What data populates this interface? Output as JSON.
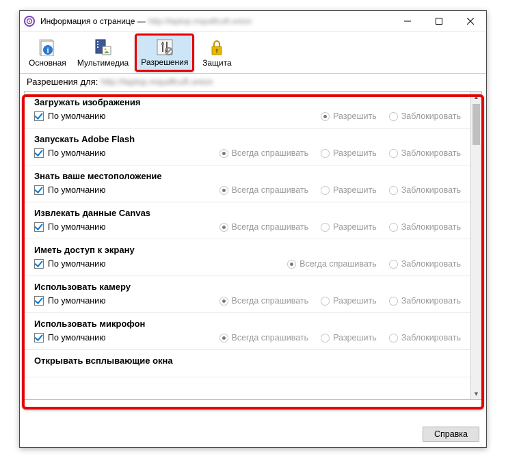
{
  "title_prefix": "Информация о странице —",
  "title_blur": "http://laptop.mqudfcuft.onion",
  "tabs": {
    "general": "Основная",
    "media": "Мультимедиа",
    "permissions": "Разрешения",
    "security": "Защита"
  },
  "perm_for_label": "Разрешения для:",
  "perm_for_blur": "http://laptop.mqudfcuft.onion",
  "default_label": "По умолчанию",
  "options": {
    "allow": "Разрешить",
    "block": "Заблокировать",
    "always_ask": "Всегда спрашивать"
  },
  "items": [
    {
      "title": "Загружать изображения",
      "opts": [
        "allow",
        "block"
      ],
      "selected": "allow"
    },
    {
      "title": "Запускать Adobe Flash",
      "opts": [
        "always_ask",
        "allow",
        "block"
      ],
      "selected": "always_ask"
    },
    {
      "title": "Знать ваше местоположение",
      "opts": [
        "always_ask",
        "allow",
        "block"
      ],
      "selected": "always_ask"
    },
    {
      "title": "Извлекать данные Canvas",
      "opts": [
        "always_ask",
        "allow",
        "block"
      ],
      "selected": "always_ask"
    },
    {
      "title": "Иметь доступ к экрану",
      "opts": [
        "always_ask",
        "block"
      ],
      "selected": "always_ask"
    },
    {
      "title": "Использовать камеру",
      "opts": [
        "always_ask",
        "allow",
        "block"
      ],
      "selected": "always_ask"
    },
    {
      "title": "Использовать микрофон",
      "opts": [
        "always_ask",
        "allow",
        "block"
      ],
      "selected": "always_ask"
    },
    {
      "title": "Открывать всплывающие окна",
      "opts": [],
      "selected": null
    }
  ],
  "help_btn": "Справка"
}
